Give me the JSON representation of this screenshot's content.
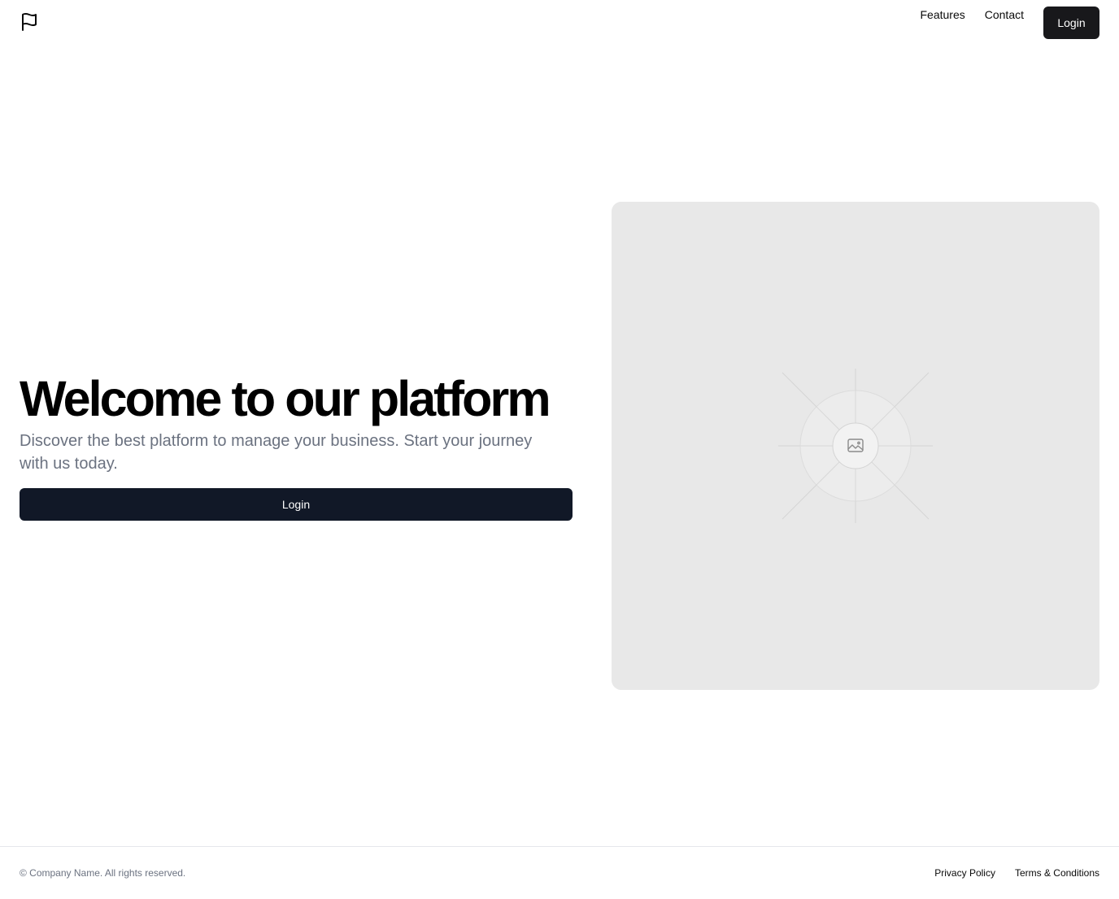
{
  "header": {
    "logo_icon": "flag-icon",
    "nav": {
      "features_label": "Features",
      "contact_label": "Contact",
      "login_label": "Login"
    }
  },
  "hero": {
    "title": "Welcome to our platform",
    "subtitle": "Discover the best platform to manage your business. Start your journey with us today.",
    "cta_label": "Login",
    "image_icon": "image-placeholder-icon"
  },
  "footer": {
    "copyright": "© Company Name. All rights reserved.",
    "links": {
      "privacy": "Privacy Policy",
      "terms": "Terms & Conditions"
    }
  },
  "colors": {
    "primary_button": "#18181b",
    "hero_button": "#111827",
    "placeholder_bg": "#e8e8e8",
    "muted_text": "#6b7280",
    "border": "#e5e7eb"
  }
}
